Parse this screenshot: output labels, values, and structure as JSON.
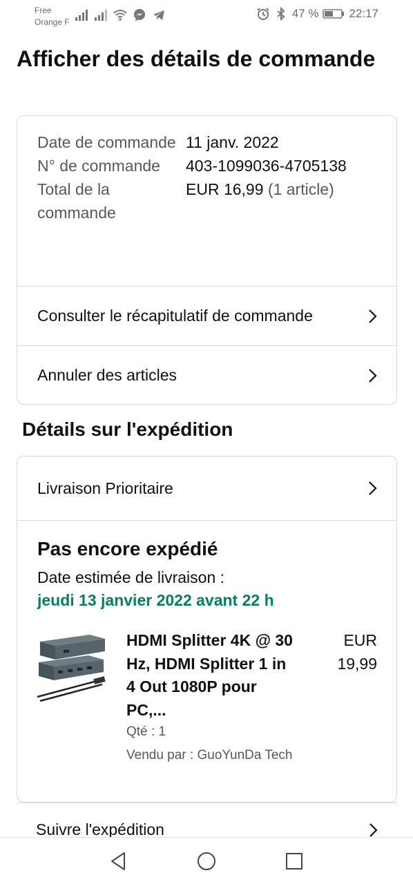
{
  "status_bar": {
    "carrier_line1": "Free",
    "carrier_line2": "Orange F",
    "battery_percent": "47 %",
    "time": "22:17",
    "icons_left": [
      "signal-icon",
      "signal-icon",
      "wifi-icon",
      "messenger-icon",
      "telegram-icon"
    ],
    "icons_right": [
      "alarm-icon",
      "bluetooth-icon",
      "battery-icon"
    ]
  },
  "page": {
    "title": "Afficher des détails de commande"
  },
  "order": {
    "rows": [
      {
        "label": "Date de commande",
        "value": "11 janv. 2022"
      },
      {
        "label": "N° de commande",
        "value": "403-1099036-4705138"
      },
      {
        "label": "Total de la commande",
        "value": "EUR 16,99",
        "value_suffix": "(1 article)"
      }
    ],
    "links": [
      {
        "label": "Consulter le récapitulatif de commande"
      },
      {
        "label": "Annuler des articles"
      }
    ]
  },
  "shipping": {
    "section_title": "Détails sur l'expédition",
    "method": "Livraison Prioritaire",
    "status": "Pas encore expédié",
    "estimated_label": "Date estimée de livraison :",
    "estimated_date": "jeudi 13 janvier 2022 avant 22 h",
    "item": {
      "title": "HDMI Splitter 4K @ 30 Hz, HDMI Splitter 1 in 4 Out 1080P pour PC,...",
      "price": "EUR 19,99",
      "quantity": "Qté : 1",
      "seller": "Vendu par : GuoYunDa Tech"
    },
    "track_label": "Suivre l'expédition"
  },
  "colors": {
    "accent_green": "#067d62",
    "muted_text": "#565959",
    "border": "#d5d9d9"
  },
  "nav": [
    "back-icon",
    "home-icon",
    "recents-icon"
  ]
}
